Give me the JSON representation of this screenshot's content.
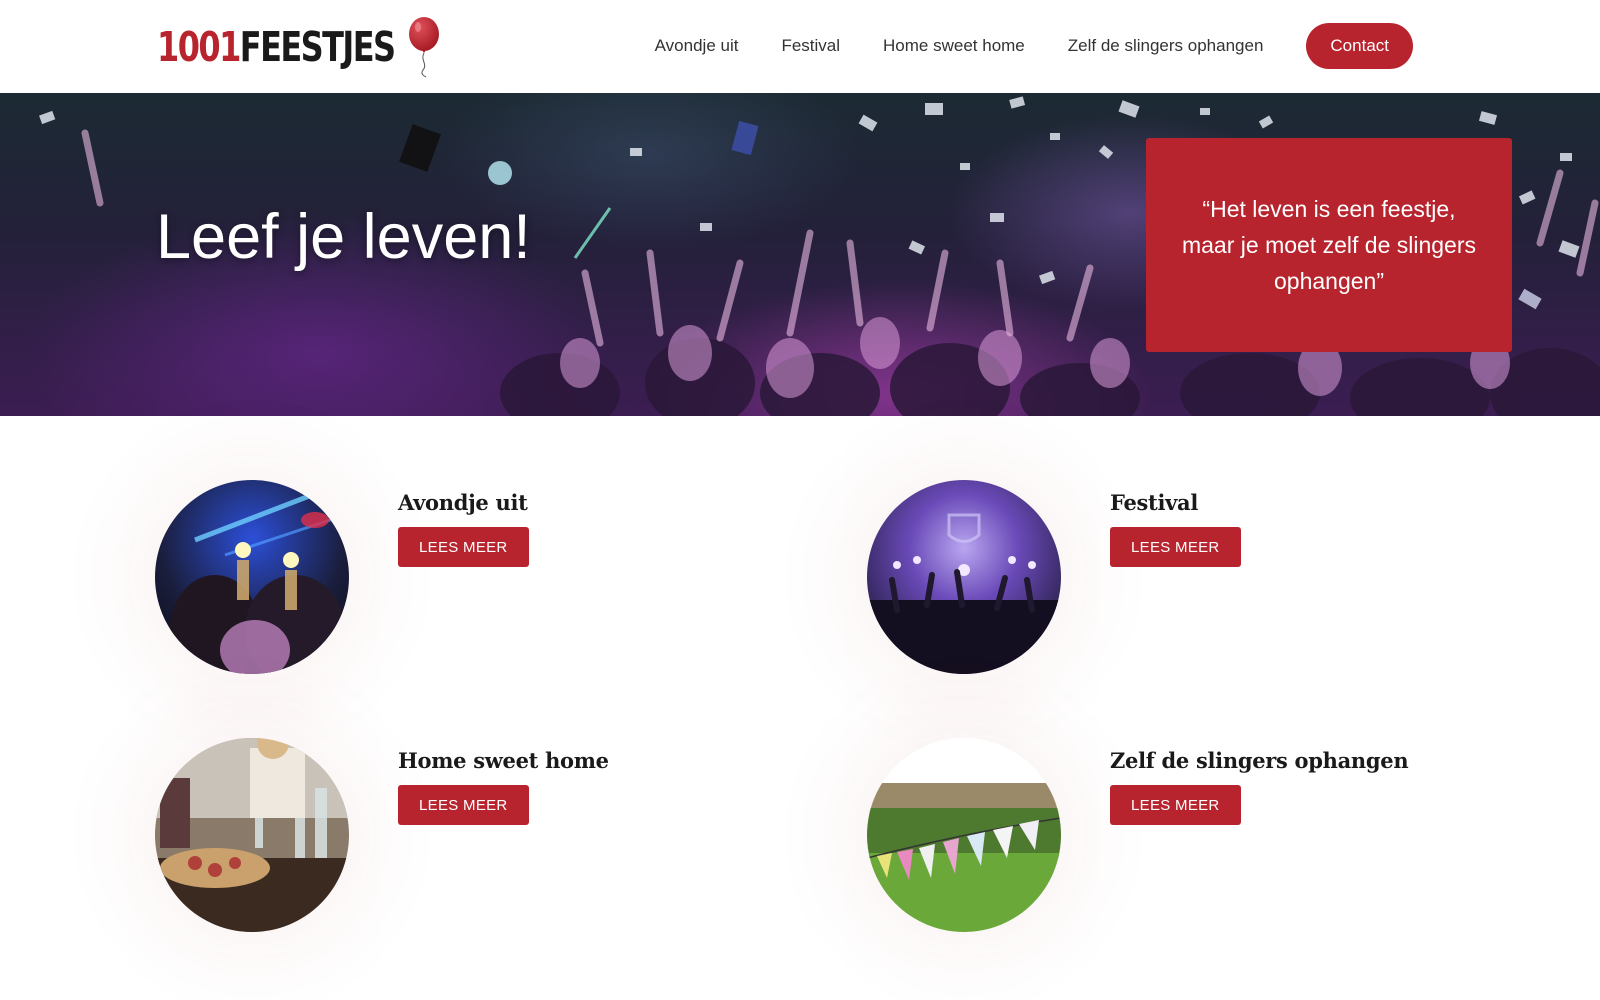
{
  "logo": {
    "number": "1001",
    "word": "FEESTJES",
    "icon": "balloon-icon",
    "brand_color": "#b8242e"
  },
  "nav": {
    "items": [
      {
        "label": "Avondje uit"
      },
      {
        "label": "Festival"
      },
      {
        "label": "Home sweet home"
      },
      {
        "label": "Zelf de slingers ophangen"
      }
    ],
    "contact_label": "Contact"
  },
  "hero": {
    "title": "Leef je leven!",
    "quote": "“Het leven is een feestje, maar je moet zelf de slingers ophangen”"
  },
  "cards": [
    {
      "title": "Avondje uit",
      "button": "LEES MEER",
      "image": "nightclub-photo"
    },
    {
      "title": "Festival",
      "button": "LEES MEER",
      "image": "festival-stage-photo"
    },
    {
      "title": "Home sweet home",
      "button": "LEES MEER",
      "image": "home-dinner-photo"
    },
    {
      "title": "Zelf de slingers ophangen",
      "button": "LEES MEER",
      "image": "bunting-meadow-photo"
    }
  ],
  "colors": {
    "accent": "#b8242e",
    "text": "#1a1a1a",
    "nav_text": "#333333"
  }
}
